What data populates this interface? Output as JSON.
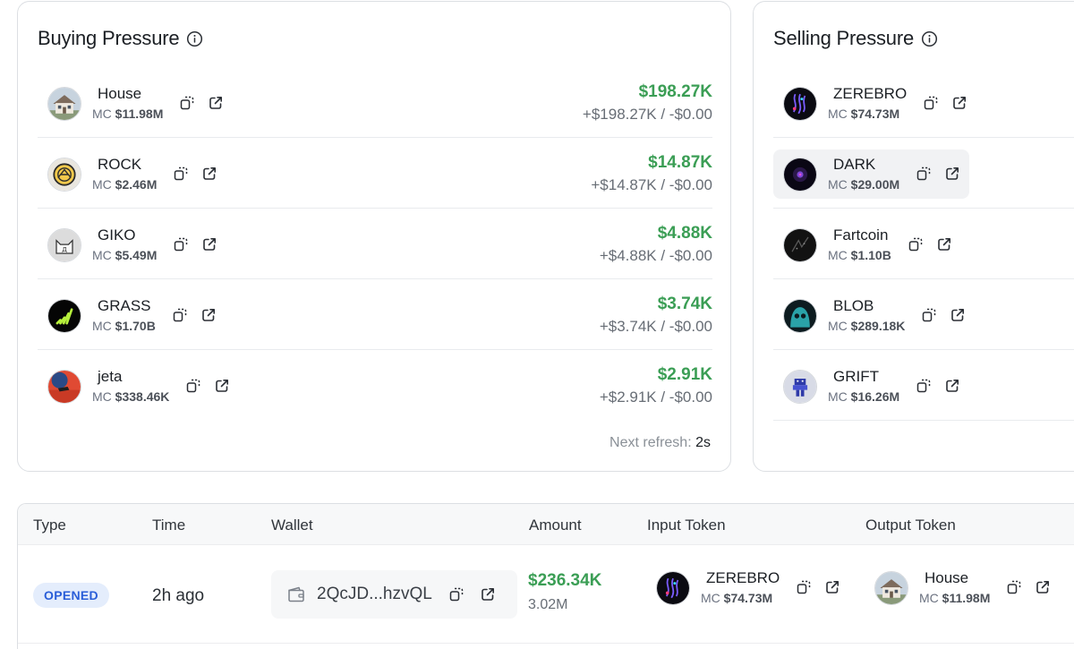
{
  "buying": {
    "title": "Buying Pressure",
    "tokens": [
      {
        "name": "House",
        "mc_label": "MC",
        "mc": "$11.98M",
        "amount": "$198.27K",
        "detail": "+$198.27K / -$0.00"
      },
      {
        "name": "ROCK",
        "mc_label": "MC",
        "mc": "$2.46M",
        "amount": "$14.87K",
        "detail": "+$14.87K / -$0.00"
      },
      {
        "name": "GIKO",
        "mc_label": "MC",
        "mc": "$5.49M",
        "amount": "$4.88K",
        "detail": "+$4.88K / -$0.00"
      },
      {
        "name": "GRASS",
        "mc_label": "MC",
        "mc": "$1.70B",
        "amount": "$3.74K",
        "detail": "+$3.74K / -$0.00"
      },
      {
        "name": "jeta",
        "mc_label": "MC",
        "mc": "$338.46K",
        "amount": "$2.91K",
        "detail": "+$2.91K / -$0.00"
      }
    ],
    "refresh_label": "Next refresh:",
    "refresh_value": "2s"
  },
  "selling": {
    "title": "Selling Pressure",
    "tokens": [
      {
        "name": "ZEREBRO",
        "mc_label": "MC",
        "mc": "$74.73M"
      },
      {
        "name": "DARK",
        "mc_label": "MC",
        "mc": "$29.00M"
      },
      {
        "name": "Fartcoin",
        "mc_label": "MC",
        "mc": "$1.10B"
      },
      {
        "name": "BLOB",
        "mc_label": "MC",
        "mc": "$289.18K"
      },
      {
        "name": "GRIFT",
        "mc_label": "MC",
        "mc": "$16.26M"
      }
    ]
  },
  "trades": {
    "columns": [
      "Type",
      "Time",
      "Wallet",
      "Amount",
      "Input Token",
      "Output Token"
    ],
    "rows": [
      {
        "type": "OPENED",
        "time": "2h ago",
        "wallet": "2QcJD...hzvQL",
        "amount": "$236.34K",
        "amount_sub": "3.02M",
        "input": {
          "name": "ZEREBRO",
          "mc_label": "MC",
          "mc": "$74.73M"
        },
        "output": {
          "name": "House",
          "mc_label": "MC",
          "mc": "$11.98M"
        }
      }
    ]
  },
  "colors": {
    "positive": "#3b9e55",
    "badge_bg": "#e4edfc",
    "badge_text": "#2a5ed8"
  },
  "icons": [
    "info-icon",
    "copy-icon",
    "external-link-icon",
    "wallet-icon"
  ]
}
